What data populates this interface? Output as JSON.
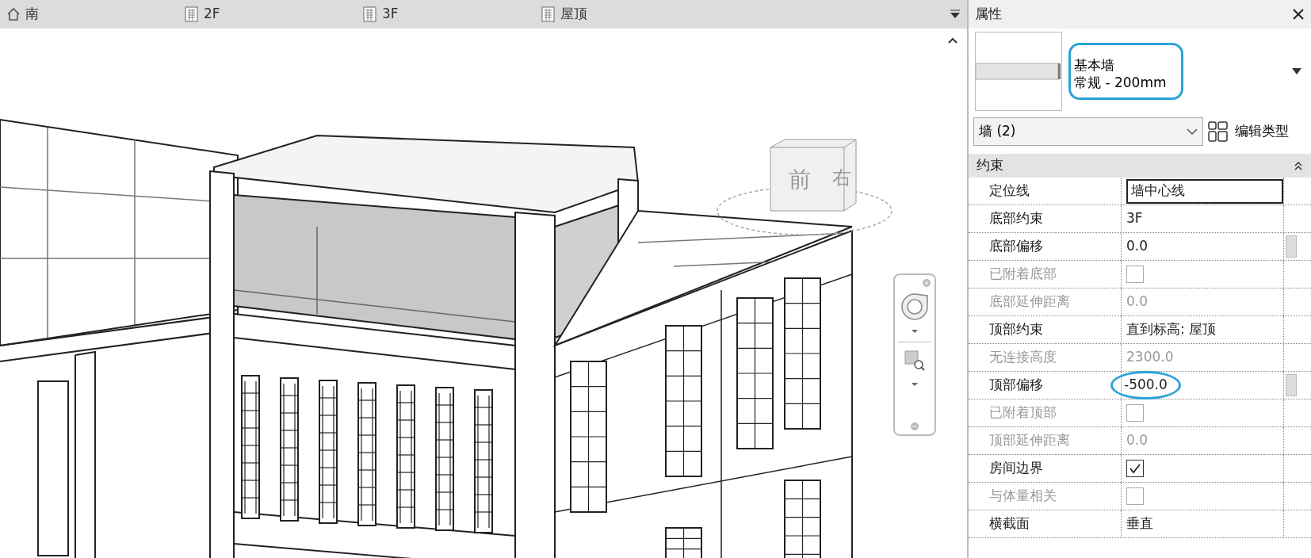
{
  "view_tabs": [
    {
      "label": "南",
      "kind": "home"
    },
    {
      "label": "2F",
      "kind": "plan"
    },
    {
      "label": "3F",
      "kind": "plan"
    },
    {
      "label": "屋顶",
      "kind": "plan"
    }
  ],
  "viewcube": {
    "front": "前",
    "right": "右"
  },
  "properties": {
    "title": "属性",
    "type_family": "基本墙",
    "type_name": "常规 - 200mm",
    "type_highlighted": true,
    "selector": "墙 (2)",
    "edit_type": "编辑类型",
    "category": "约束",
    "category_expanded": true,
    "rows": [
      {
        "label": "定位线",
        "value": "墙中心线",
        "kind": "field",
        "disabled": false,
        "highlighted": false
      },
      {
        "label": "底部约束",
        "value": "3F",
        "kind": "text",
        "disabled": false,
        "highlighted": false
      },
      {
        "label": "底部偏移",
        "value": "0.0",
        "kind": "text",
        "disabled": false,
        "highlighted": false
      },
      {
        "label": "已附着底部",
        "kind": "checkbox",
        "checked": false,
        "disabled": true,
        "highlighted": false
      },
      {
        "label": "底部延伸距离",
        "value": "0.0",
        "kind": "text",
        "disabled": true,
        "highlighted": false
      },
      {
        "label": "顶部约束",
        "value": "直到标高: 屋顶",
        "kind": "text",
        "disabled": false,
        "highlighted": false
      },
      {
        "label": "无连接高度",
        "value": "2300.0",
        "kind": "text",
        "disabled": true,
        "highlighted": false
      },
      {
        "label": "顶部偏移",
        "value": "-500.0",
        "kind": "text",
        "disabled": false,
        "highlighted": true
      },
      {
        "label": "已附着顶部",
        "kind": "checkbox",
        "checked": false,
        "disabled": true,
        "highlighted": false
      },
      {
        "label": "顶部延伸距离",
        "value": "0.0",
        "kind": "text",
        "disabled": true,
        "highlighted": false
      },
      {
        "label": "房间边界",
        "kind": "checkbox",
        "checked": true,
        "disabled": false,
        "highlighted": false
      },
      {
        "label": "与体量相关",
        "kind": "checkbox",
        "checked": false,
        "disabled": true,
        "highlighted": false
      },
      {
        "label": "横截面",
        "value": "垂直",
        "kind": "text",
        "disabled": false,
        "highlighted": false
      }
    ]
  }
}
